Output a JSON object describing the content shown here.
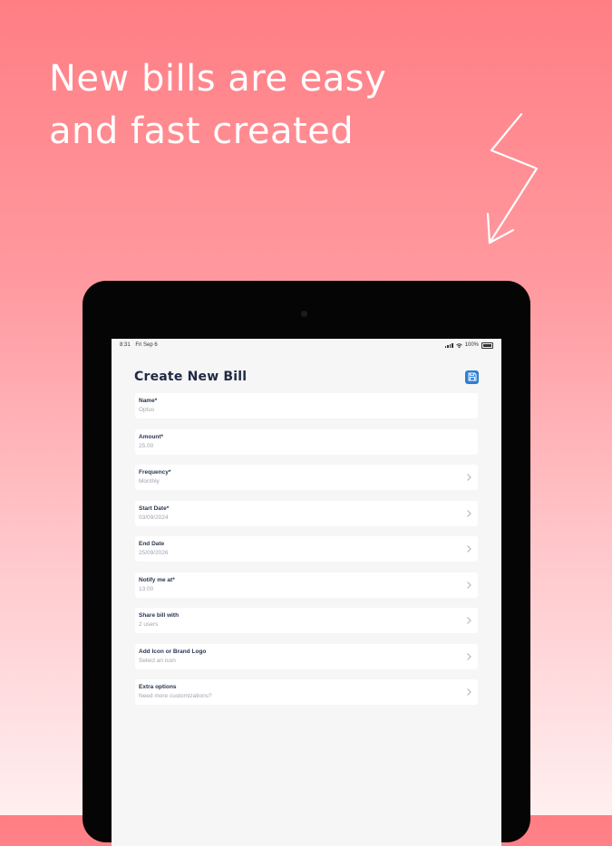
{
  "headline": {
    "line1": "New bills are easy",
    "line2": "and fast created"
  },
  "status_bar": {
    "time": "8:31",
    "date": "Fri Sep 6",
    "battery": "100%"
  },
  "screen": {
    "title": "Create New Bill",
    "save_icon": "save-icon",
    "fields": [
      {
        "label": "Name*",
        "value": "Optus",
        "has_chevron": false
      },
      {
        "label": "Amount*",
        "value": "25.00",
        "has_chevron": false
      },
      {
        "label": "Frequency*",
        "value": "Monthly",
        "has_chevron": true
      },
      {
        "label": "Start Date*",
        "value": "03/09/2024",
        "has_chevron": true
      },
      {
        "label": "End Date",
        "value": "25/09/2026",
        "has_chevron": true
      },
      {
        "label": "Notify me at*",
        "value": "13:00",
        "has_chevron": true
      },
      {
        "label": "Share bill with",
        "value": "2 users",
        "has_chevron": true
      },
      {
        "label": "Add Icon or Brand Logo",
        "value": "Select an icon",
        "has_chevron": true
      },
      {
        "label": "Extra options",
        "value": "Need more customizations?",
        "has_chevron": true
      }
    ]
  },
  "colors": {
    "accent": "#2d7fd3",
    "title_text": "#1f2a44",
    "background_top": "#ff7e84",
    "background_bottom": "#ffeff0"
  }
}
